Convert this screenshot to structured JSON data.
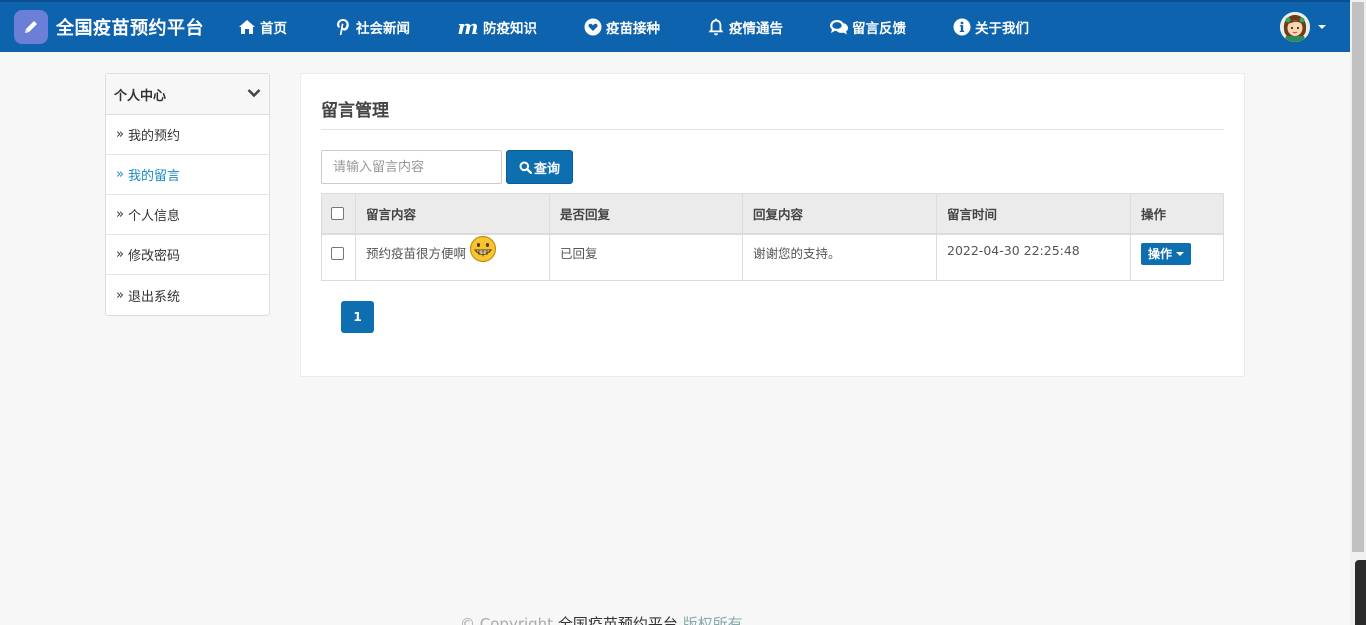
{
  "navbar": {
    "brand": "全国疫苗预约平台",
    "items": [
      {
        "label": "首页",
        "icon": "home-icon"
      },
      {
        "label": "社会新闻",
        "icon": "pinterest-icon"
      },
      {
        "label": "防疫知识",
        "icon": "m-icon"
      },
      {
        "label": "疫苗接种",
        "icon": "heart-icon"
      },
      {
        "label": "疫情通告",
        "icon": "bell-icon"
      },
      {
        "label": "留言反馈",
        "icon": "comments-icon"
      },
      {
        "label": "关于我们",
        "icon": "info-icon"
      }
    ]
  },
  "sidebar": {
    "heading": "个人中心",
    "items": [
      {
        "label": "我的预约"
      },
      {
        "label": "我的留言"
      },
      {
        "label": "个人信息"
      },
      {
        "label": "修改密码"
      },
      {
        "label": "退出系统"
      }
    ],
    "raquo": "»"
  },
  "main": {
    "title": "留言管理",
    "search_placeholder": "请输入留言内容",
    "search_label": "查询",
    "table": {
      "headers": [
        "留言内容",
        "是否回复",
        "回复内容",
        "留言时间",
        "操作"
      ],
      "rows": [
        {
          "content": "预约疫苗很方便啊",
          "replied": "已回复",
          "reply": "谢谢您的支持。",
          "time": "2022-04-30 22:25:48",
          "action": "操作"
        }
      ]
    },
    "pagination": {
      "current": "1"
    }
  },
  "footer": {
    "copyright": "© Copyright",
    "site": "全国疫苗预约平台",
    "rights": "版权所有"
  },
  "colors": {
    "navbar": "#0d63ad",
    "accent": "#0d6fb0",
    "active_link": "#1a8bc4"
  }
}
